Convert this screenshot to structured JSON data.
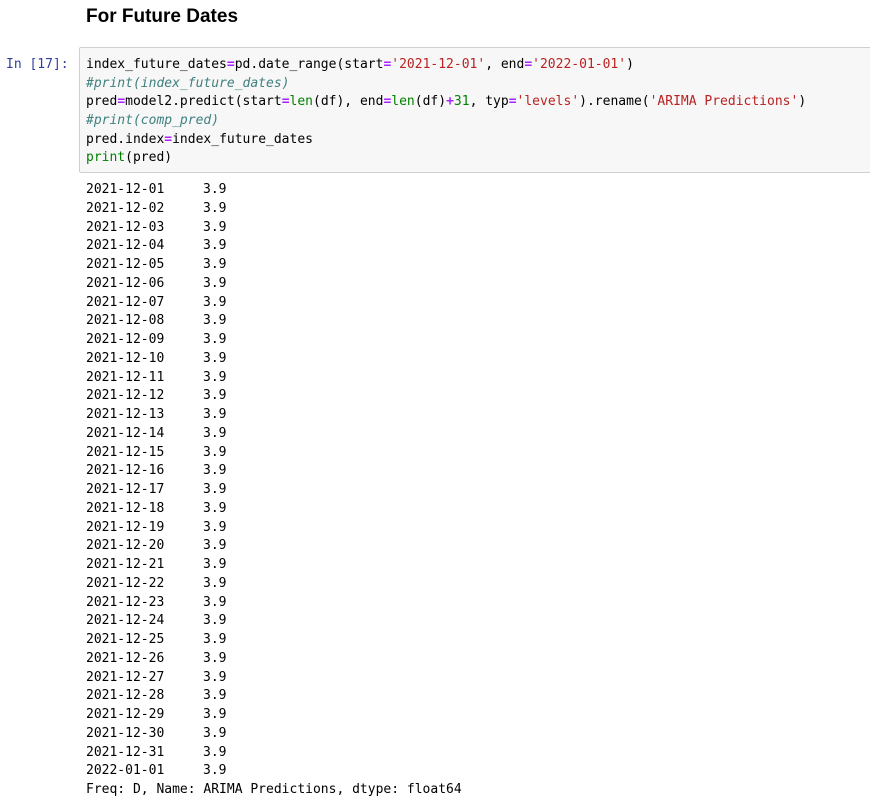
{
  "markdown": {
    "heading": "For Future Dates"
  },
  "cell": {
    "prompt": "In [17]:",
    "code": {
      "l1": {
        "a": "index_future_dates",
        "b": "=",
        "c": "pd.date_range(start",
        "d": "=",
        "e": "'2021-12-01'",
        "f": ", end",
        "g": "=",
        "h": "'2022-01-01'",
        "i": ")"
      },
      "l2": "#print(index_future_dates)",
      "l3": {
        "a": "pred",
        "b": "=",
        "c": "model2.predict(start",
        "d": "=",
        "e": "len",
        "f": "(df), end",
        "g": "=",
        "h": "len",
        "i": "(df)",
        "j": "+",
        "k": "31",
        "l": ", typ",
        "m": "=",
        "n": "'levels'",
        "o": ").rename(",
        "p": "'ARIMA Predictions'",
        "q": ")"
      },
      "l4": "#print(comp_pred)",
      "l5": {
        "a": "pred.index",
        "b": "=",
        "c": "index_future_dates"
      },
      "l6": {
        "a": "print",
        "b": "(pred)"
      }
    }
  },
  "output": {
    "rows": [
      {
        "date": "2021-12-01",
        "value": "3.9"
      },
      {
        "date": "2021-12-02",
        "value": "3.9"
      },
      {
        "date": "2021-12-03",
        "value": "3.9"
      },
      {
        "date": "2021-12-04",
        "value": "3.9"
      },
      {
        "date": "2021-12-05",
        "value": "3.9"
      },
      {
        "date": "2021-12-06",
        "value": "3.9"
      },
      {
        "date": "2021-12-07",
        "value": "3.9"
      },
      {
        "date": "2021-12-08",
        "value": "3.9"
      },
      {
        "date": "2021-12-09",
        "value": "3.9"
      },
      {
        "date": "2021-12-10",
        "value": "3.9"
      },
      {
        "date": "2021-12-11",
        "value": "3.9"
      },
      {
        "date": "2021-12-12",
        "value": "3.9"
      },
      {
        "date": "2021-12-13",
        "value": "3.9"
      },
      {
        "date": "2021-12-14",
        "value": "3.9"
      },
      {
        "date": "2021-12-15",
        "value": "3.9"
      },
      {
        "date": "2021-12-16",
        "value": "3.9"
      },
      {
        "date": "2021-12-17",
        "value": "3.9"
      },
      {
        "date": "2021-12-18",
        "value": "3.9"
      },
      {
        "date": "2021-12-19",
        "value": "3.9"
      },
      {
        "date": "2021-12-20",
        "value": "3.9"
      },
      {
        "date": "2021-12-21",
        "value": "3.9"
      },
      {
        "date": "2021-12-22",
        "value": "3.9"
      },
      {
        "date": "2021-12-23",
        "value": "3.9"
      },
      {
        "date": "2021-12-24",
        "value": "3.9"
      },
      {
        "date": "2021-12-25",
        "value": "3.9"
      },
      {
        "date": "2021-12-26",
        "value": "3.9"
      },
      {
        "date": "2021-12-27",
        "value": "3.9"
      },
      {
        "date": "2021-12-28",
        "value": "3.9"
      },
      {
        "date": "2021-12-29",
        "value": "3.9"
      },
      {
        "date": "2021-12-30",
        "value": "3.9"
      },
      {
        "date": "2021-12-31",
        "value": "3.9"
      },
      {
        "date": "2022-01-01",
        "value": "3.9"
      }
    ],
    "footer": "Freq: D, Name: ARIMA Predictions, dtype: float64"
  }
}
